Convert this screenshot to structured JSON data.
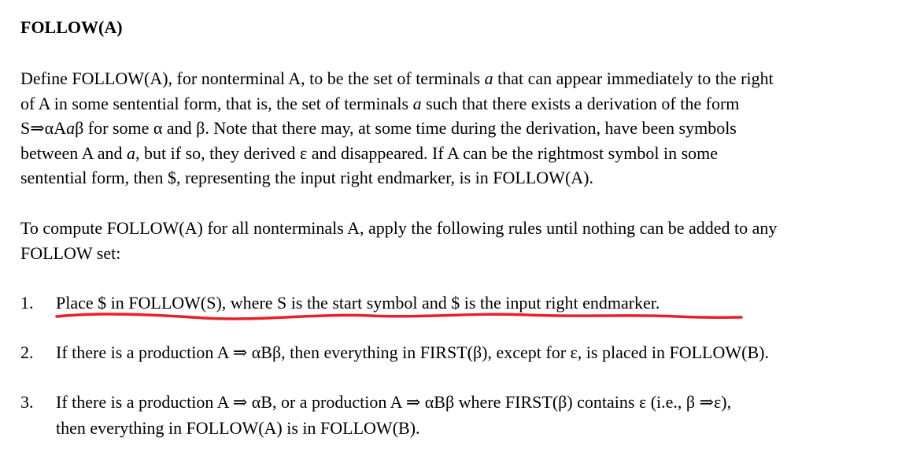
{
  "heading": "FOLLOW(A)",
  "definition": {
    "line1_pre": "Define FOLLOW(A), for nonterminal A, to be the set of terminals ",
    "line1_var": "a",
    "line1_post": " that can appear immediately to the right",
    "line2_pre": "of A in some sentential form, that is, the set of terminals ",
    "line2_var": "a",
    "line2_post": " such that there exists a derivation of the form",
    "line3_pre": "S⇒αA",
    "line3_var": "a",
    "line3_post": "β for some α and β. Note that there may, at some time during the derivation, have been symbols",
    "line4_pre": "between A and ",
    "line4_var": "a",
    "line4_post": ", but if so, they derived ε and disappeared.  If A can be the rightmost symbol in some",
    "line5": "sentential form, then $, representing the input right endmarker, is in FOLLOW(A)."
  },
  "intro": {
    "line1": "To compute FOLLOW(A) for all nonterminals A, apply the following rules until nothing can be added to any",
    "line2": "FOLLOW set:"
  },
  "rules": [
    {
      "number": "1.",
      "lines": [
        "Place $ in FOLLOW(S), where S is the start symbol and $ is the input right endmarker."
      ]
    },
    {
      "number": "2.",
      "lines": [
        "If there is a production A ⇒ αBβ, then everything in FIRST(β), except for ε, is placed in FOLLOW(B)."
      ]
    },
    {
      "number": "3.",
      "lines": [
        "If there is a production A ⇒ αB, or a production A ⇒ αBβ where FIRST(β) contains ε (i.e., β ⇒ε),",
        "then everything in FOLLOW(A) is in FOLLOW(B)."
      ]
    }
  ],
  "annotation_color": "#e8202a"
}
